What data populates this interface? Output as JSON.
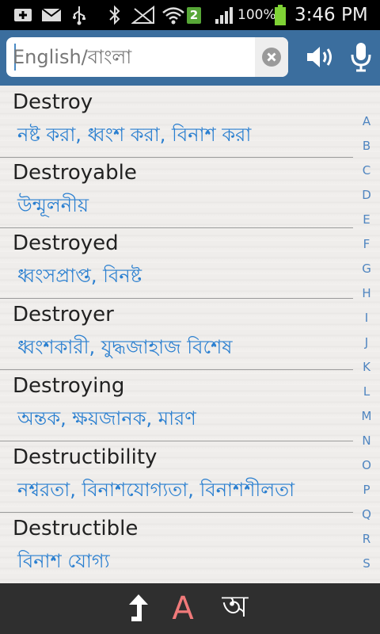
{
  "status_bar": {
    "sim_badge": "2",
    "battery_percent": "100%",
    "time": "3:46 PM"
  },
  "search": {
    "placeholder": "English/বাংলা",
    "value": ""
  },
  "entries": [
    {
      "word": "Destroy",
      "meaning": "নষ্ট করা, ধ্বংশ করা, বিনাশ করা"
    },
    {
      "word": "Destroyable",
      "meaning": "উন্মূলনীয়"
    },
    {
      "word": "Destroyed",
      "meaning": "ধ্বংসপ্রাপ্ত, বিনষ্ট"
    },
    {
      "word": "Destroyer",
      "meaning": "ধ্বংশকারী, যুদ্ধজাহাজ বিশেষ"
    },
    {
      "word": "Destroying",
      "meaning": "অন্তক, ক্ষয়জানক, মারণ"
    },
    {
      "word": "Destructibility",
      "meaning": "নশ্বরতা, বিনাশযোগ্যতা, বিনাশশীলতা"
    },
    {
      "word": "Destructible",
      "meaning": "বিনাশ যোগ্য"
    }
  ],
  "alphabet_index": [
    "A",
    "B",
    "C",
    "D",
    "E",
    "F",
    "G",
    "H",
    "I",
    "J",
    "K",
    "L",
    "M",
    "N",
    "O",
    "P",
    "Q",
    "R",
    "S"
  ],
  "bottom_bar": {
    "english_label": "A",
    "bangla_label": "অ"
  },
  "colors": {
    "header_blue": "#3b6e9e",
    "meaning_blue": "#2a7fd0",
    "english_active": "#f07a7a"
  }
}
